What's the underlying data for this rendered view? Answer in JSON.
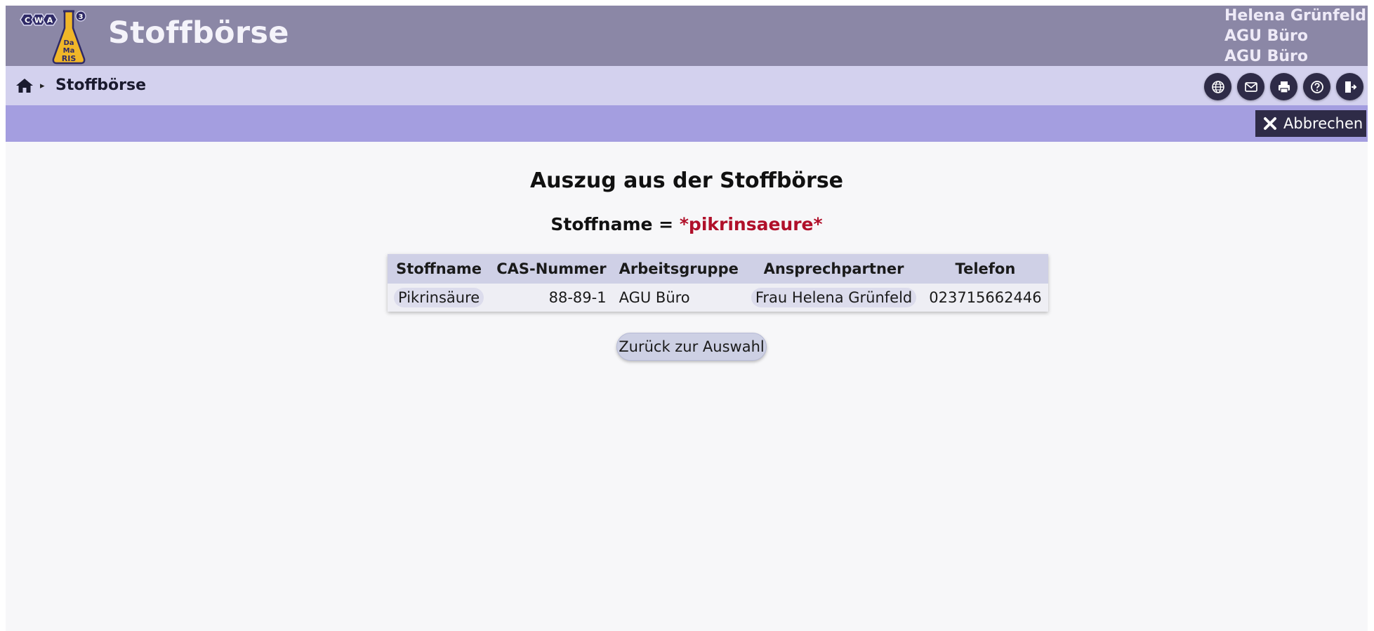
{
  "header": {
    "app_title": "Stoffbörse",
    "logo_text": [
      "C",
      "W",
      "A",
      "Da",
      "Ma",
      "RIS",
      "3"
    ],
    "user": {
      "name": "Helena Grünfeld",
      "group": "AGU Büro",
      "group2": "AGU Büro"
    }
  },
  "breadcrumb": {
    "current": "Stoffbörse"
  },
  "toolbar_icons": [
    "globe-icon",
    "mail-icon",
    "print-icon",
    "help-icon",
    "logout-icon"
  ],
  "actionbar": {
    "cancel_label": "Abbrechen"
  },
  "main": {
    "title": "Auszug aus der Stoffbörse",
    "filter_label": "Stoffname =",
    "filter_value": "*pikrinsaeure*",
    "table": {
      "columns": [
        "Stoffname",
        "CAS-Nummer",
        "Arbeitsgruppe",
        "Ansprechpartner",
        "Telefon"
      ],
      "rows": [
        {
          "stoffname": "Pikrinsäure",
          "cas": "88-89-1",
          "arbeitsgruppe": "AGU Büro",
          "ansprechpartner": "Frau Helena Grünfeld",
          "telefon": "023715662446"
        }
      ]
    },
    "back_label": "Zurück zur Auswahl"
  },
  "colors": {
    "header_bg": "#8b87a6",
    "breadcrumb_bg": "#d3d1ee",
    "actionbar_bg": "#a49ee0",
    "button_dark": "#2e2b47",
    "filter_red": "#b0102a"
  }
}
